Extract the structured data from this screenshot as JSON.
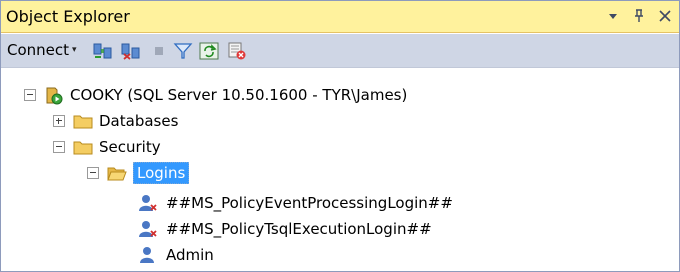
{
  "panel": {
    "title": "Object Explorer",
    "controls": {
      "dropdown": "▾",
      "pin": "ᵗ",
      "close": "✕"
    }
  },
  "toolbar": {
    "connect_label": "Connect",
    "connect_caret": "▾",
    "buttons": [
      {
        "name": "connect-object-explorer-icon"
      },
      {
        "name": "disconnect-icon"
      },
      {
        "name": "stop-icon"
      },
      {
        "name": "filter-icon"
      },
      {
        "name": "refresh-icon"
      },
      {
        "name": "object-explorer-details-icon"
      }
    ]
  },
  "tree": {
    "server": {
      "label": "COOKY (SQL Server 10.50.1600 - TYR\\James)",
      "expanded": true
    },
    "databases": {
      "label": "Databases",
      "expanded": false
    },
    "security": {
      "label": "Security",
      "expanded": true
    },
    "logins": {
      "label": "Logins",
      "expanded": true,
      "selected": true
    },
    "login_items": [
      {
        "label": "##MS_PolicyEventProcessingLogin##",
        "disabled": true
      },
      {
        "label": "##MS_PolicyTsqlExecutionLogin##",
        "disabled": true
      },
      {
        "label": "Admin",
        "disabled": false
      }
    ]
  },
  "colors": {
    "title_bg": "#fff29d",
    "toolbar_bg": "#cfd6e5",
    "selection": "#3399ff",
    "folder": "#f4cd62"
  }
}
